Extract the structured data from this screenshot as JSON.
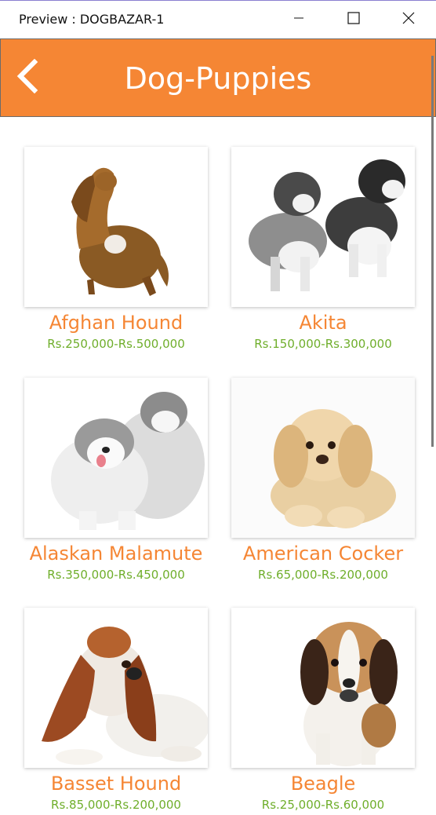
{
  "window": {
    "title": "Preview : DOGBAZAR-1",
    "minimize_icon": "minimize-icon",
    "maximize_icon": "maximize-icon",
    "close_icon": "close-icon"
  },
  "appbar": {
    "title": "Dog-Puppies",
    "back_icon": "chevron-left-icon",
    "background": "#f58634"
  },
  "colors": {
    "accent": "#f58634",
    "price": "#6fae2b"
  },
  "dogs": [
    {
      "name": "Afghan Hound",
      "price": "Rs.250,000-Rs.500,000",
      "image": "afghan-hound-photo"
    },
    {
      "name": "Akita",
      "price": "Rs.150,000-Rs.300,000",
      "image": "akita-photo"
    },
    {
      "name": "Alaskan Malamute",
      "price": "Rs.350,000-Rs.450,000",
      "image": "alaskan-malamute-photo"
    },
    {
      "name": "American Cocker",
      "price": "Rs.65,000-Rs.200,000",
      "image": "american-cocker-photo"
    },
    {
      "name": "Basset Hound",
      "price": "Rs.85,000-Rs.200,000",
      "image": "basset-hound-photo"
    },
    {
      "name": "Beagle",
      "price": "Rs.25,000-Rs.60,000",
      "image": "beagle-photo"
    }
  ]
}
